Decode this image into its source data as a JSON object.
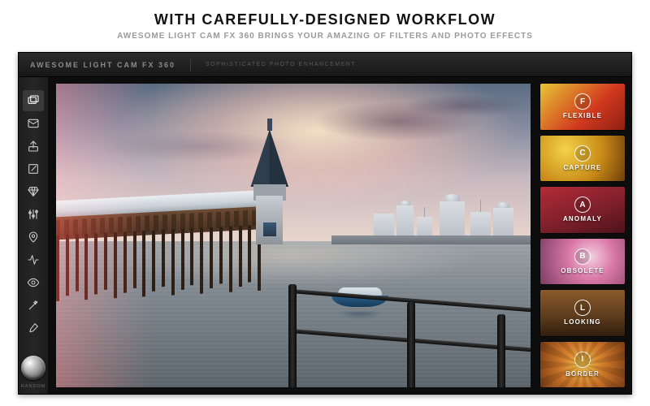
{
  "marketing": {
    "headline": "WITH CAREFULLY-DESIGNED WORKFLOW",
    "subhead": "AWESOME LIGHT CAM FX 360 BRINGS YOUR AMAZING OF FILTERS AND PHOTO EFFECTS"
  },
  "header": {
    "app_name": "AWESOME LIGHT CAM FX 360",
    "tagline": "SOPHISTICATED PHOTO ENHANCEMENT"
  },
  "toolbar": {
    "random_label": "RANDOM",
    "tools": [
      {
        "name": "photos-icon"
      },
      {
        "name": "mail-icon"
      },
      {
        "name": "share-icon"
      },
      {
        "name": "edit-icon"
      },
      {
        "name": "diamond-icon"
      },
      {
        "name": "sliders-icon"
      },
      {
        "name": "pin-icon"
      },
      {
        "name": "activity-icon"
      },
      {
        "name": "eye-icon"
      },
      {
        "name": "wand-icon"
      },
      {
        "name": "brush-icon"
      }
    ]
  },
  "filters": [
    {
      "letter": "F",
      "label": "FLEXIBLE",
      "cls": "fc-flexible"
    },
    {
      "letter": "C",
      "label": "CAPTURE",
      "cls": "fc-capture"
    },
    {
      "letter": "A",
      "label": "ANOMALY",
      "cls": "fc-anomaly"
    },
    {
      "letter": "B",
      "label": "OBSOLETE",
      "cls": "fc-obsolete"
    },
    {
      "letter": "L",
      "label": "LOOKING",
      "cls": "fc-looking"
    },
    {
      "letter": "I",
      "label": "BORDER",
      "cls": "fc-border"
    }
  ]
}
